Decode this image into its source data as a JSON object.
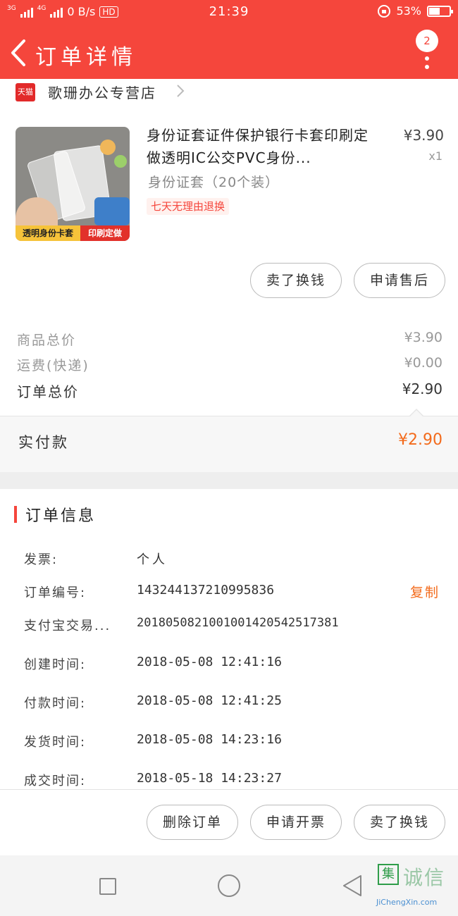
{
  "status_bar": {
    "network_1": "3G",
    "network_2": "4G",
    "speed": "0 B/s",
    "hd": "HD",
    "time": "21:39",
    "battery": "53%",
    "battery_level": 0.53
  },
  "header": {
    "title": "订单详情",
    "badge_count": "2"
  },
  "store": {
    "logo_text": "天猫",
    "name": "歌珊办公专营店"
  },
  "product": {
    "title": "身份证套证件保护银行卡套印刷定做透明IC公交PVC身份...",
    "price": "¥3.90",
    "qty": "x1",
    "sku": "身份证套（20个装）",
    "tag": "七天无理由退换",
    "image_band_left": "透明身份卡套",
    "image_band_right": "印刷定做"
  },
  "item_actions": {
    "sell_btn": "卖了换钱",
    "after_sale_btn": "申请售后"
  },
  "summary": {
    "goods_total_label": "商品总价",
    "goods_total_value": "¥3.90",
    "shipping_label": "运费(快递)",
    "shipping_value": "¥0.00",
    "order_total_label": "订单总价",
    "order_total_value": "¥2.90",
    "paid_label": "实付款",
    "paid_value": "¥2.90"
  },
  "order_info": {
    "section_title": "订单信息",
    "rows": [
      {
        "label": "发票:",
        "value": "个人"
      },
      {
        "label": "订单编号:",
        "value": "143244137210995836"
      },
      {
        "label": "支付宝交易...",
        "value": "2018050821001001420542517381"
      },
      {
        "label": "创建时间:",
        "value": "2018-05-08 12:41:16"
      },
      {
        "label": "付款时间:",
        "value": "2018-05-08 12:41:25"
      },
      {
        "label": "发货时间:",
        "value": "2018-05-08 14:23:16"
      },
      {
        "label": "成交时间:",
        "value": "2018-05-18 14:23:27"
      }
    ],
    "copy_label": "复制"
  },
  "bottom_actions": {
    "delete_btn": "删除订单",
    "invoice_btn": "申请开票",
    "sell_btn": "卖了换钱"
  },
  "watermark": {
    "mark": "集",
    "cn": "诚信",
    "url": "JiChengXin.com"
  },
  "colors": {
    "brand_red": "#f5463c",
    "price_orange": "#f36b1c"
  }
}
